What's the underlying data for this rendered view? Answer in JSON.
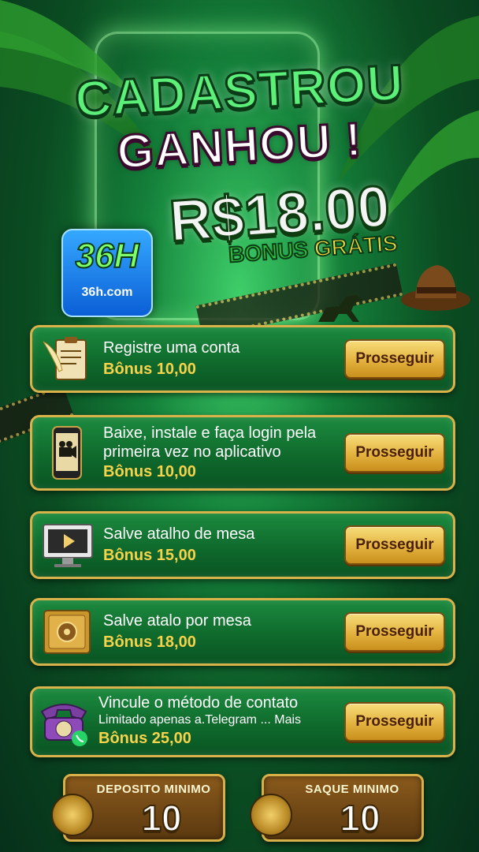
{
  "headline": {
    "line1": "CADASTROU",
    "line2": "GANHOU !"
  },
  "prize": {
    "amount": "R$18.00",
    "bonus_word": "BONUS",
    "gratis_word": "GRÁTIS"
  },
  "logo": {
    "mark": "36H",
    "url": "36h.com"
  },
  "tasks": [
    {
      "title": "Registre uma conta",
      "subtitle": "",
      "bonus": "Bônus 10,00",
      "button": "Prosseguir",
      "icon": "clipboard-quill-icon"
    },
    {
      "title": "Baixe, instale e faça login pela primeira vez no aplicativo",
      "subtitle": "",
      "bonus": "Bônus  10,00",
      "button": "Prosseguir",
      "icon": "phone-camera-icon"
    },
    {
      "title": "Salve atalho de mesa",
      "subtitle": "",
      "bonus": "Bônus 15,00",
      "button": "Prosseguir",
      "icon": "monitor-film-icon"
    },
    {
      "title": "Salve atalo por mesa",
      "subtitle": "",
      "bonus": "Bônus  18,00",
      "button": "Prosseguir",
      "icon": "safe-icon"
    },
    {
      "title": "Vincule o método de contato",
      "subtitle": "Limitado apenas a.Telegram ... Mais",
      "bonus": "Bônus 25,00",
      "button": "Prosseguir",
      "icon": "telephone-icon"
    }
  ],
  "minimums": {
    "deposit": {
      "label": "DEPOSITO MINIMO",
      "value": "10"
    },
    "withdraw": {
      "label": "SAQUE MINIMO",
      "value": "10"
    }
  },
  "colors": {
    "accent_gold": "#e3b23e",
    "card_green": "#0f6a2c",
    "bonus_yellow": "#f6d34a"
  }
}
